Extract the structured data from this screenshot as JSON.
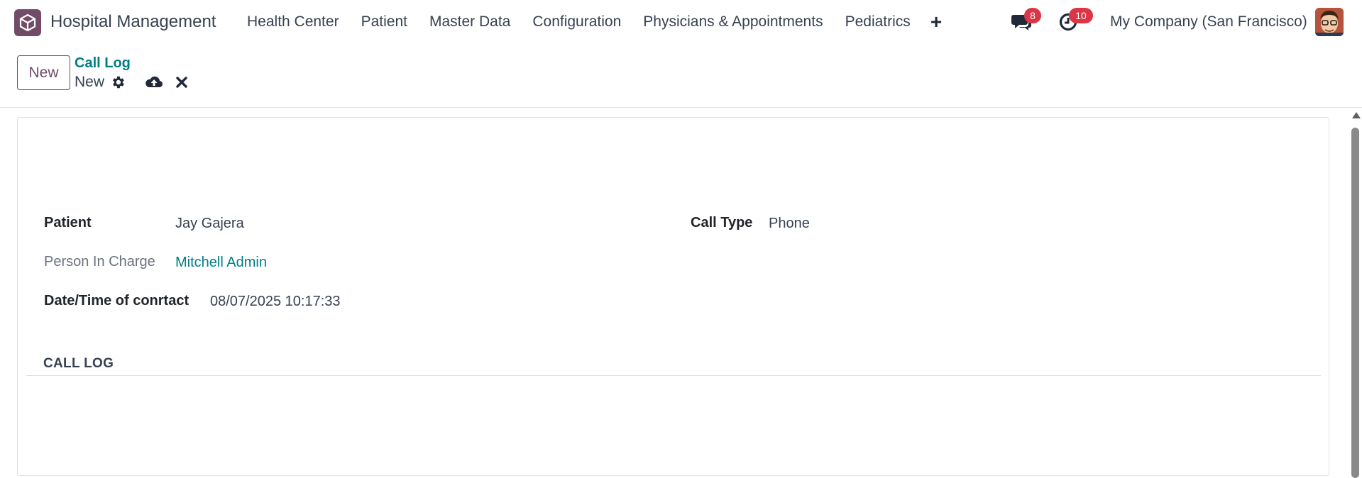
{
  "navbar": {
    "app_name": "Hospital Management",
    "menu": [
      "Health Center",
      "Patient",
      "Master Data",
      "Configuration",
      "Physicians & Appointments",
      "Pediatrics"
    ],
    "messages_count": "8",
    "activities_count": "10",
    "company": "My Company (San Francisco)"
  },
  "control": {
    "new_button": "New",
    "breadcrumb": "Call Log",
    "record_name": "New"
  },
  "form": {
    "patient_label": "Patient",
    "patient_value": "Jay Gajera",
    "person_in_charge_label": "Person In Charge",
    "person_in_charge_value": "Mitchell Admin",
    "datetime_label": "Date/Time of conrtact",
    "datetime_value": "08/07/2025 10:17:33",
    "call_type_label": "Call Type",
    "call_type_value": "Phone",
    "section_title": "CALL LOG"
  },
  "colors": {
    "brand": "#714B67",
    "link": "#017e84",
    "badge": "#dc3545"
  }
}
